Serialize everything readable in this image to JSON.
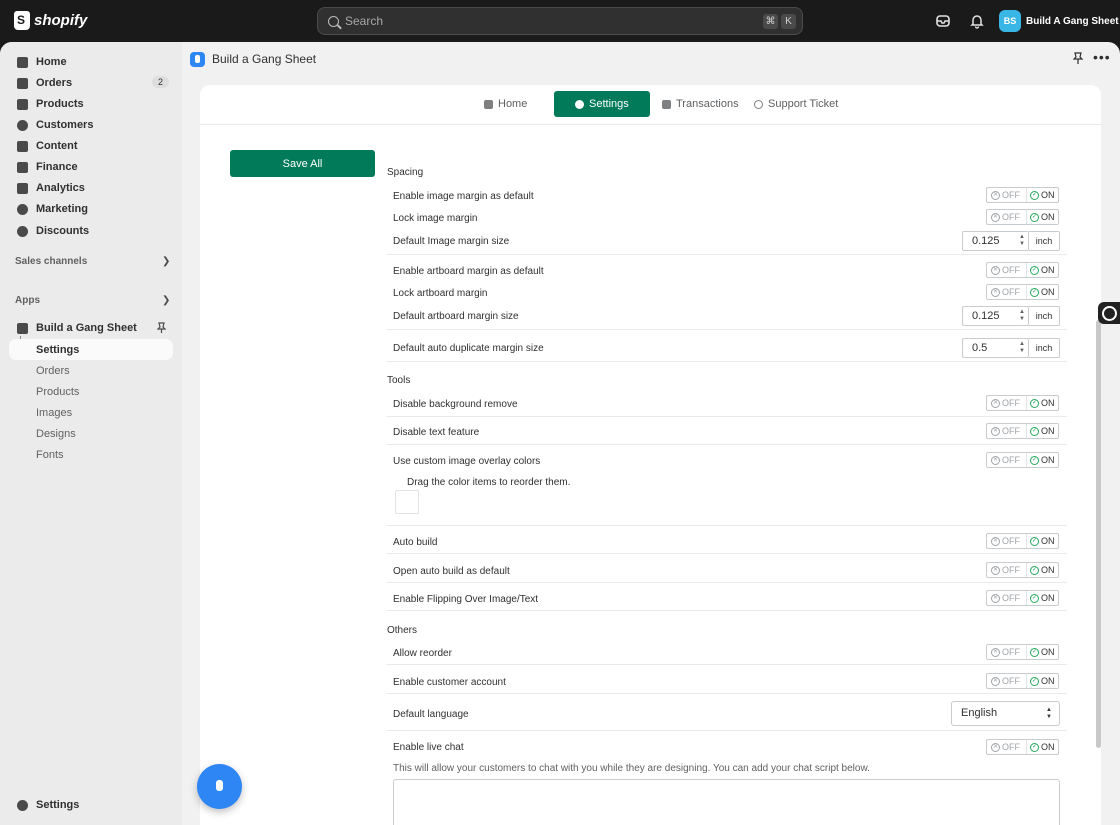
{
  "topbar": {
    "brand": "shopify",
    "search_placeholder": "Search",
    "shortcut_key1": "⌘",
    "shortcut_key2": "K",
    "store_initials": "BS",
    "store_name": "Build A Gang Sheet"
  },
  "sidebar": {
    "items": [
      {
        "label": "Home",
        "icon": "home-icon"
      },
      {
        "label": "Orders",
        "icon": "orders-icon",
        "badge": "2"
      },
      {
        "label": "Products",
        "icon": "tag-icon"
      },
      {
        "label": "Customers",
        "icon": "person-icon"
      },
      {
        "label": "Content",
        "icon": "content-icon"
      },
      {
        "label": "Finance",
        "icon": "bank-icon"
      },
      {
        "label": "Analytics",
        "icon": "chart-icon"
      },
      {
        "label": "Marketing",
        "icon": "target-icon"
      },
      {
        "label": "Discounts",
        "icon": "discount-icon"
      }
    ],
    "sales_channels": "Sales channels",
    "apps": "Apps",
    "app_name": "Build a Gang Sheet",
    "app_subitems": [
      "Settings",
      "Orders",
      "Products",
      "Images",
      "Designs",
      "Fonts"
    ],
    "settings": "Settings"
  },
  "app_header": {
    "title": "Build a Gang Sheet"
  },
  "tabs": [
    "Home",
    "Settings",
    "Transactions",
    "Support Ticket"
  ],
  "save_all": "Save All",
  "toggle": {
    "off": "OFF",
    "on": "ON"
  },
  "spacing": {
    "title": "Spacing",
    "enable_image_margin": "Enable image margin as default",
    "lock_image_margin": "Lock image margin",
    "default_image_margin_size": "Default Image margin size",
    "image_margin_value": "0.125",
    "enable_artboard_margin": "Enable artboard margin as default",
    "lock_artboard_margin": "Lock artboard margin",
    "default_artboard_margin_size": "Default artboard margin size",
    "artboard_margin_value": "0.125",
    "default_auto_duplicate_margin": "Default auto duplicate margin size",
    "auto_duplicate_value": "0.5",
    "unit": "inch"
  },
  "tools": {
    "title": "Tools",
    "disable_bg_remove": "Disable background remove",
    "disable_text": "Disable text feature",
    "custom_overlay": "Use custom image overlay colors",
    "drag_hint": "Drag the color items to reorder them.",
    "auto_build": "Auto build",
    "open_auto_build": "Open auto build as default",
    "enable_flipping": "Enable Flipping Over Image/Text"
  },
  "others": {
    "title": "Others",
    "allow_reorder": "Allow reorder",
    "customer_account": "Enable customer account",
    "default_language": "Default language",
    "language_value": "English",
    "live_chat": "Enable live chat",
    "live_chat_hint": "This will allow your customers to chat with you while they are designing. You can add your chat script below."
  }
}
